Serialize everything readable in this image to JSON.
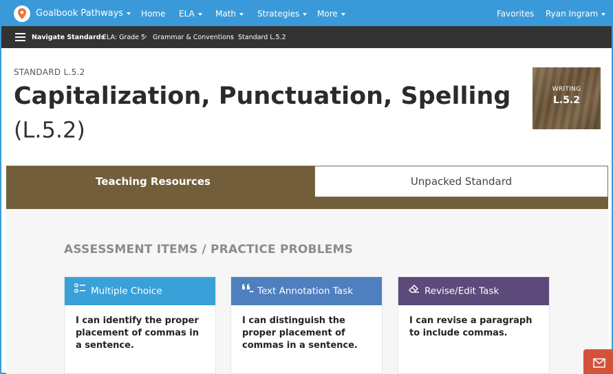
{
  "colors": {
    "primary_blue": "#3a9ad9",
    "dark_nav": "#333333",
    "tab_brown": "#725e3a",
    "multiple_choice": "#3aa0d8",
    "text_annotation": "#4e7fbe",
    "revise_edit": "#5b4a7a",
    "mail_orange": "#d2533a"
  },
  "topnav": {
    "brand": "Goalbook Pathways",
    "home": "Home",
    "ela": "ELA",
    "math": "Math",
    "strategies": "Strategies",
    "more": "More",
    "favorites": "Favorites",
    "user": "Ryan Ingram"
  },
  "subnav": {
    "title": "Navigate Standards",
    "breadcrumbs": [
      "ELA: Grade 5",
      "Grammar & Conventions",
      "Standard L.5.2"
    ]
  },
  "page": {
    "standard_label": "STANDARD L.5.2",
    "title": "Capitalization, Punctuation, Spelling",
    "subtitle": "(L.5.2)"
  },
  "badge": {
    "category": "WRITING",
    "code": "L.5.2"
  },
  "tabs": {
    "active": "Teaching Resources",
    "inactive": "Unpacked Standard"
  },
  "section": {
    "title": "ASSESSMENT ITEMS / PRACTICE PROBLEMS"
  },
  "cards": [
    {
      "type": "Multiple Choice",
      "icon": "list-icon",
      "text": "I can identify the proper placement of commas in a sentence."
    },
    {
      "type": "Text Annotation Task",
      "icon": "quote-icon",
      "text": "I can distinguish the proper placement of commas in a sentence."
    },
    {
      "type": "Revise/Edit Task",
      "icon": "eraser-icon",
      "text": "I can revise a paragraph to include commas."
    }
  ]
}
